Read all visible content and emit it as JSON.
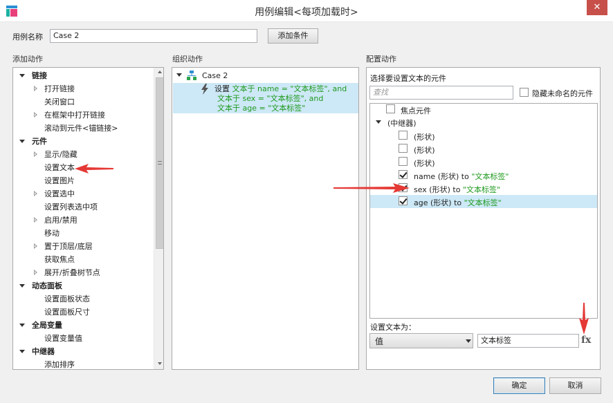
{
  "window": {
    "title": "用例编辑<每项加载时>",
    "close": "✕"
  },
  "case_name": {
    "label": "用例名称",
    "value": "Case 2",
    "add_condition": "添加条件"
  },
  "add_actions": {
    "title": "添加动作",
    "items": [
      {
        "label": "链接",
        "type": "category",
        "expander": "down"
      },
      {
        "label": "打开链接",
        "type": "item",
        "expander": "right"
      },
      {
        "label": "关闭窗口",
        "type": "item",
        "expander": ""
      },
      {
        "label": "在框架中打开链接",
        "type": "item",
        "expander": "right"
      },
      {
        "label": "滚动到元件<锚链接>",
        "type": "item",
        "expander": ""
      },
      {
        "label": "元件",
        "type": "category",
        "expander": "down"
      },
      {
        "label": "显示/隐藏",
        "type": "item",
        "expander": "right"
      },
      {
        "label": "设置文本",
        "type": "item",
        "expander": ""
      },
      {
        "label": "设置图片",
        "type": "item",
        "expander": ""
      },
      {
        "label": "设置选中",
        "type": "item",
        "expander": "right"
      },
      {
        "label": "设置列表选中项",
        "type": "item",
        "expander": ""
      },
      {
        "label": "启用/禁用",
        "type": "item",
        "expander": "right"
      },
      {
        "label": "移动",
        "type": "item",
        "expander": ""
      },
      {
        "label": "置于顶层/底层",
        "type": "item",
        "expander": "right"
      },
      {
        "label": "获取焦点",
        "type": "item",
        "expander": ""
      },
      {
        "label": "展开/折叠树节点",
        "type": "item",
        "expander": "right"
      },
      {
        "label": "动态面板",
        "type": "category",
        "expander": "down"
      },
      {
        "label": "设置面板状态",
        "type": "item",
        "expander": ""
      },
      {
        "label": "设置面板尺寸",
        "type": "item",
        "expander": ""
      },
      {
        "label": "全局变量",
        "type": "category",
        "expander": "down"
      },
      {
        "label": "设置变量值",
        "type": "item",
        "expander": ""
      },
      {
        "label": "中继器",
        "type": "category",
        "expander": "down"
      },
      {
        "label": "添加排序",
        "type": "item",
        "expander": ""
      }
    ]
  },
  "organize": {
    "title": "组织动作",
    "case_label": "Case 2",
    "action_prefix": "设置",
    "action_lines": [
      "文本于 name = \"文本标签\", and",
      "文本于 sex = \"文本标签\", and",
      "文本于 age = \"文本标签\""
    ]
  },
  "configure": {
    "title": "配置动作",
    "select_label": "选择要设置文本的元件",
    "search_placeholder": "查找",
    "hide_unnamed": "隐藏未命名的元件",
    "focus_widget": "焦点元件",
    "repeater": "(中继器)",
    "shapes": [
      "(形状)",
      "(形状)",
      "(形状)"
    ],
    "assignments": [
      {
        "name": "name (形状) to ",
        "value": "\"文本标签\"",
        "checked": true
      },
      {
        "name": "sex (形状) to ",
        "value": "\"文本标签\"",
        "checked": true
      },
      {
        "name": "age (形状) to ",
        "value": "\"文本标签\"",
        "checked": true
      }
    ],
    "set_text_label": "设置文本为：",
    "type_value": "值",
    "text_value": "文本标签",
    "fx": "fx"
  },
  "buttons": {
    "ok": "确定",
    "cancel": "取消"
  },
  "colors": {
    "selection": "#cde8f6",
    "value_green": "#1f9a1f",
    "arrow_red": "#e53935"
  }
}
